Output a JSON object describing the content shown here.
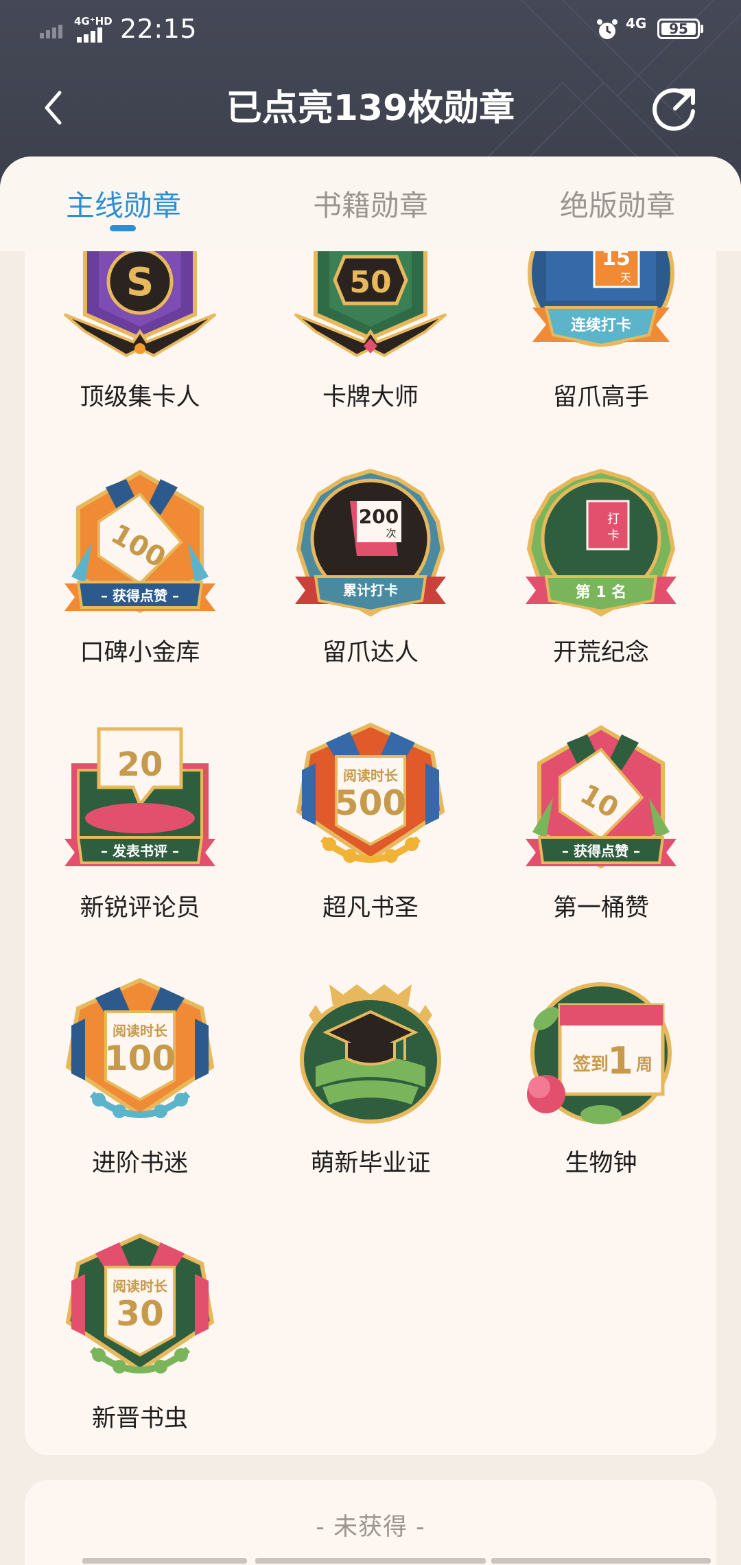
{
  "status_bar": {
    "network_left": "4G⁺HD",
    "time": "22:15",
    "network_right": "4G",
    "battery": "95"
  },
  "header": {
    "title": "已点亮139枚勋章"
  },
  "tabs": [
    {
      "label": "主线勋章",
      "active": true
    },
    {
      "label": "书籍勋章",
      "active": false
    },
    {
      "label": "绝版勋章",
      "active": false
    }
  ],
  "badges": [
    {
      "name": "顶级集卡人",
      "emblem_text": "S"
    },
    {
      "name": "卡牌大师",
      "emblem_text": "50"
    },
    {
      "name": "留爪高手",
      "emblem_text": "15",
      "sub": "天",
      "ribbon": "连续打卡"
    },
    {
      "name": "口碑小金库",
      "emblem_text": "100",
      "ribbon": "– 获得点赞 –"
    },
    {
      "name": "留爪达人",
      "emblem_text": "200",
      "sub": "次",
      "ribbon": "累计打卡"
    },
    {
      "name": "开荒纪念",
      "emblem_text": "打卡",
      "ribbon": "第 1 名"
    },
    {
      "name": "新锐评论员",
      "emblem_text": "20",
      "ribbon": "– 发表书评 –"
    },
    {
      "name": "超凡书圣",
      "emblem_text": "500",
      "sub": "阅读时长"
    },
    {
      "name": "第一桶赞",
      "emblem_text": "10",
      "ribbon": "– 获得点赞 –"
    },
    {
      "name": "进阶书迷",
      "emblem_text": "100",
      "sub": "阅读时长"
    },
    {
      "name": "萌新毕业证",
      "emblem_text": ""
    },
    {
      "name": "生物钟",
      "emblem_text": "1",
      "sub": "签到",
      "sub2": "周"
    },
    {
      "name": "新晋书虫",
      "emblem_text": "30",
      "sub": "阅读时长"
    }
  ],
  "unobtained_label": "- 未获得 -",
  "colors": {
    "accent_blue": "#2c8fd6",
    "header_bg": "#3d404c",
    "sheet_bg": "#fdf6f1"
  }
}
